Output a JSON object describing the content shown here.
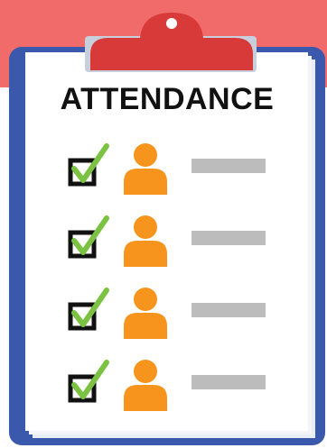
{
  "title": "ATTENDANCE",
  "colors": {
    "background_band": "#f26b6b",
    "clipboard_board": "#3a59ad",
    "paper": "#ffffff",
    "clip": "#d83a3a",
    "checkmark": "#7cc242",
    "checkbox_border": "#111111",
    "person": "#f7941d",
    "name_placeholder": "#bcbcbc",
    "title_text": "#111111"
  },
  "icons": {
    "clip": "clipboard-clip-icon",
    "checkbox": "checked-checkbox-icon",
    "person": "person-icon",
    "name_line": "name-placeholder-bar"
  },
  "rows": [
    {
      "checked": true
    },
    {
      "checked": true
    },
    {
      "checked": true
    },
    {
      "checked": true
    }
  ]
}
